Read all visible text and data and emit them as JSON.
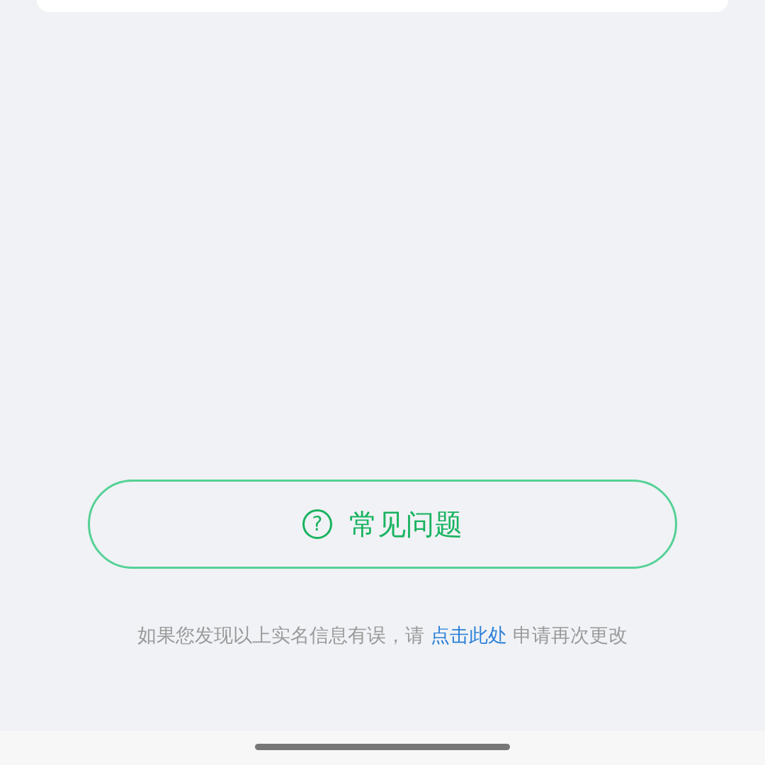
{
  "faq_button": {
    "icon": "?",
    "label": "常见问题"
  },
  "notice": {
    "before": "如果您发现以上实名信息有误，请 ",
    "link": "点击此处",
    "after": " 申请再次更改"
  }
}
